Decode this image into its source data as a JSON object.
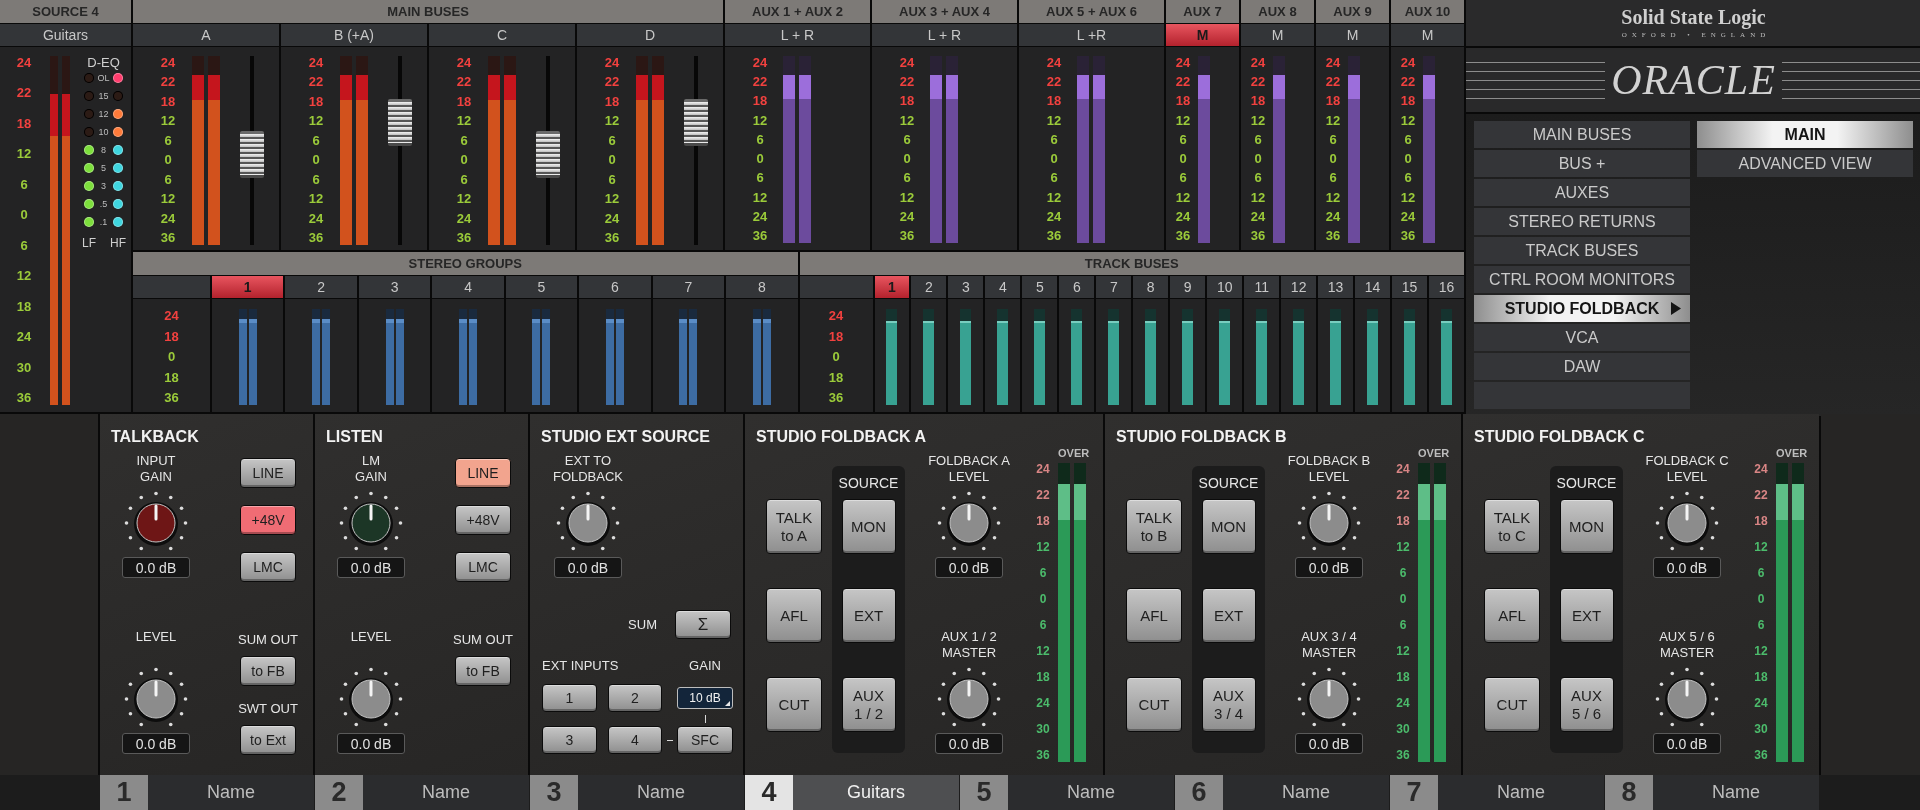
{
  "source": {
    "title": "SOURCE 4",
    "name": "Guitars",
    "scale": {
      "hot": [
        "24",
        "22",
        "18"
      ],
      "normal": [
        "12",
        "6",
        "0",
        "6",
        "12",
        "18",
        "24",
        "30",
        "36"
      ]
    },
    "meters": [
      {
        "level": 0.89
      },
      {
        "level": 0.89
      }
    ],
    "deq": {
      "title": "D-EQ",
      "rows": [
        {
          "label": "OL",
          "lf": {
            "on": false
          },
          "hf": {
            "on": true,
            "color": "#ff3d6e"
          }
        },
        {
          "label": "15",
          "lf": {
            "on": false
          },
          "hf": {
            "on": false
          }
        },
        {
          "label": "12",
          "lf": {
            "on": false
          },
          "hf": {
            "on": true,
            "color": "#ff7b3a"
          }
        },
        {
          "label": "10",
          "lf": {
            "on": false
          },
          "hf": {
            "on": true,
            "color": "#ff7b3a"
          }
        },
        {
          "label": "8",
          "lf": {
            "on": true,
            "color": "#7ddf3c"
          },
          "hf": {
            "on": true,
            "color": "#3fd6e0"
          }
        },
        {
          "label": "5",
          "lf": {
            "on": true,
            "color": "#7ddf3c"
          },
          "hf": {
            "on": true,
            "color": "#3fd6e0"
          }
        },
        {
          "label": "3",
          "lf": {
            "on": true,
            "color": "#7ddf3c"
          },
          "hf": {
            "on": true,
            "color": "#3fd6e0"
          }
        },
        {
          "label": ".5",
          "lf": {
            "on": true,
            "color": "#7ddf3c"
          },
          "hf": {
            "on": true,
            "color": "#3fd6e0"
          }
        },
        {
          "label": ".1",
          "lf": {
            "on": true,
            "color": "#7ddf3c"
          },
          "hf": {
            "on": true,
            "color": "#3fd6e0"
          }
        }
      ],
      "lf_label": "LF",
      "hf_label": "HF"
    }
  },
  "main_buses": {
    "title": "MAIN BUSES",
    "channels": [
      {
        "label": "A",
        "selected": false,
        "scale": {
          "hot": [
            "24",
            "22",
            "18"
          ],
          "normal": [
            "12",
            "6",
            "0",
            "6",
            "12",
            "24",
            "36"
          ]
        },
        "meters": [
          {
            "level": 0.9
          },
          {
            "level": 0.9
          }
        ],
        "fader": {
          "level": 0.47
        }
      },
      {
        "label": "B (+A)",
        "selected": false,
        "scale": {
          "hot": [
            "24",
            "22",
            "18"
          ],
          "normal": [
            "12",
            "6",
            "0",
            "6",
            "12",
            "24",
            "36"
          ]
        },
        "meters": [
          {
            "level": 0.9
          },
          {
            "level": 0.9
          }
        ],
        "fader": {
          "level": 0.7
        }
      },
      {
        "label": "C",
        "selected": false,
        "scale": {
          "hot": [
            "24",
            "22",
            "18"
          ],
          "normal": [
            "12",
            "6",
            "0",
            "6",
            "12",
            "24",
            "36"
          ]
        },
        "meters": [
          {
            "level": 0.9
          },
          {
            "level": 0.9
          }
        ],
        "fader": {
          "level": 0.47
        }
      },
      {
        "label": "D",
        "selected": false,
        "scale": {
          "hot": [
            "24",
            "22",
            "18"
          ],
          "normal": [
            "12",
            "6",
            "0",
            "6",
            "12",
            "24",
            "36"
          ]
        },
        "meters": [
          {
            "level": 0.9
          },
          {
            "level": 0.9
          }
        ],
        "fader": {
          "level": 0.7
        }
      }
    ]
  },
  "auxes": [
    {
      "title": "AUX 1 + AUX 2",
      "label": "L + R",
      "selected": false,
      "scale": {
        "hot": [
          "24",
          "22",
          "18"
        ],
        "normal": [
          "12",
          "6",
          "0",
          "6",
          "12",
          "24",
          "36"
        ]
      },
      "meters": [
        {
          "level": 0.9
        },
        {
          "level": 0.9
        }
      ]
    },
    {
      "title": "AUX 3 + AUX 4",
      "label": "L + R",
      "selected": false,
      "scale": {
        "hot": [
          "24",
          "22",
          "18"
        ],
        "normal": [
          "12",
          "6",
          "0",
          "6",
          "12",
          "24",
          "36"
        ]
      },
      "meters": [
        {
          "level": 0.9
        },
        {
          "level": 0.9
        }
      ]
    },
    {
      "title": "AUX 5 + AUX 6",
      "label": "L +R",
      "selected": false,
      "scale": {
        "hot": [
          "24",
          "22",
          "18"
        ],
        "normal": [
          "12",
          "6",
          "0",
          "6",
          "12",
          "24",
          "36"
        ]
      },
      "meters": [
        {
          "level": 0.9
        },
        {
          "level": 0.9
        }
      ]
    },
    {
      "title": "AUX 7",
      "label": "M",
      "selected": true,
      "scale": {
        "hot": [
          "24",
          "22",
          "18"
        ],
        "normal": [
          "12",
          "6",
          "0",
          "6",
          "12",
          "24",
          "36"
        ]
      },
      "meters": [
        {
          "level": 0.9
        }
      ]
    },
    {
      "title": "AUX 8",
      "label": "M",
      "selected": false,
      "scale": {
        "hot": [
          "24",
          "22",
          "18"
        ],
        "normal": [
          "12",
          "6",
          "0",
          "6",
          "12",
          "24",
          "36"
        ]
      },
      "meters": [
        {
          "level": 0.9
        }
      ]
    },
    {
      "title": "AUX 9",
      "label": "M",
      "selected": false,
      "scale": {
        "hot": [
          "24",
          "22",
          "18"
        ],
        "normal": [
          "12",
          "6",
          "0",
          "6",
          "12",
          "24",
          "36"
        ]
      },
      "meters": [
        {
          "level": 0.9
        }
      ]
    },
    {
      "title": "AUX 10",
      "label": "M",
      "selected": false,
      "scale": {
        "hot": [
          "24",
          "22",
          "18"
        ],
        "normal": [
          "12",
          "6",
          "0",
          "6",
          "12",
          "24",
          "36"
        ]
      },
      "meters": [
        {
          "level": 0.9
        }
      ]
    }
  ],
  "stereo_groups": {
    "title": "STEREO GROUPS",
    "scale": {
      "hot": [
        "24",
        "18"
      ],
      "normal": [
        "0",
        "18",
        "36"
      ]
    },
    "groups": [
      {
        "label": "1",
        "selected": true,
        "meters": [
          {
            "level": 0.9
          },
          {
            "level": 0.9
          }
        ]
      },
      {
        "label": "2",
        "selected": false,
        "meters": [
          {
            "level": 0.9
          },
          {
            "level": 0.9
          }
        ]
      },
      {
        "label": "3",
        "selected": false,
        "meters": [
          {
            "level": 0.9
          },
          {
            "level": 0.9
          }
        ]
      },
      {
        "label": "4",
        "selected": false,
        "meters": [
          {
            "level": 0.9
          },
          {
            "level": 0.9
          }
        ]
      },
      {
        "label": "5",
        "selected": false,
        "meters": [
          {
            "level": 0.9
          },
          {
            "level": 0.9
          }
        ]
      },
      {
        "label": "6",
        "selected": false,
        "meters": [
          {
            "level": 0.9
          },
          {
            "level": 0.9
          }
        ]
      },
      {
        "label": "7",
        "selected": false,
        "meters": [
          {
            "level": 0.9
          },
          {
            "level": 0.9
          }
        ]
      },
      {
        "label": "8",
        "selected": false,
        "meters": [
          {
            "level": 0.9
          },
          {
            "level": 0.9
          }
        ]
      }
    ]
  },
  "track_buses": {
    "title": "TRACK BUSES",
    "scale": {
      "hot": [
        "24",
        "18"
      ],
      "normal": [
        "0",
        "18",
        "36"
      ]
    },
    "buses": [
      {
        "label": "1",
        "selected": true,
        "meters": [
          {
            "level": 0.88
          }
        ]
      },
      {
        "label": "2",
        "selected": false,
        "meters": [
          {
            "level": 0.88
          }
        ]
      },
      {
        "label": "3",
        "selected": false,
        "meters": [
          {
            "level": 0.88
          }
        ]
      },
      {
        "label": "4",
        "selected": false,
        "meters": [
          {
            "level": 0.88
          }
        ]
      },
      {
        "label": "5",
        "selected": false,
        "meters": [
          {
            "level": 0.88
          }
        ]
      },
      {
        "label": "6",
        "selected": false,
        "meters": [
          {
            "level": 0.88
          }
        ]
      },
      {
        "label": "7",
        "selected": false,
        "meters": [
          {
            "level": 0.88
          }
        ]
      },
      {
        "label": "8",
        "selected": false,
        "meters": [
          {
            "level": 0.88
          }
        ]
      },
      {
        "label": "9",
        "selected": false,
        "meters": [
          {
            "level": 0.88
          }
        ]
      },
      {
        "label": "10",
        "selected": false,
        "meters": [
          {
            "level": 0.88
          }
        ]
      },
      {
        "label": "11",
        "selected": false,
        "meters": [
          {
            "level": 0.88
          }
        ]
      },
      {
        "label": "12",
        "selected": false,
        "meters": [
          {
            "level": 0.88
          }
        ]
      },
      {
        "label": "13",
        "selected": false,
        "meters": [
          {
            "level": 0.88
          }
        ]
      },
      {
        "label": "14",
        "selected": false,
        "meters": [
          {
            "level": 0.88
          }
        ]
      },
      {
        "label": "15",
        "selected": false,
        "meters": [
          {
            "level": 0.88
          }
        ]
      },
      {
        "label": "16",
        "selected": false,
        "meters": [
          {
            "level": 0.88
          }
        ]
      }
    ]
  },
  "brand": {
    "name": "Solid State Logic",
    "tagline": "OXFORD • ENGLAND",
    "product": "ORACLE"
  },
  "menu": {
    "items": [
      {
        "label": "MAIN BUSES",
        "selected": false
      },
      {
        "label": "BUS +",
        "selected": false
      },
      {
        "label": "AUXES",
        "selected": false
      },
      {
        "label": "STEREO RETURNS",
        "selected": false
      },
      {
        "label": "TRACK BUSES",
        "selected": false
      },
      {
        "label": "CTRL ROOM MONITORS",
        "selected": false
      },
      {
        "label": "STUDIO FOLDBACK",
        "selected": true
      },
      {
        "label": "VCA",
        "selected": false
      },
      {
        "label": "DAW",
        "selected": false
      }
    ],
    "views": [
      {
        "label": "MAIN",
        "selected": true
      },
      {
        "label": "ADVANCED VIEW",
        "selected": false
      }
    ]
  },
  "talkback": {
    "title": "TALKBACK",
    "knobs": [
      {
        "label": "INPUT\nGAIN",
        "value": "0.0 dB",
        "color": "#6e1616"
      },
      {
        "label": "LEVEL",
        "value": "0.0 dB",
        "color": "#8c8c8c"
      }
    ],
    "buttons": [
      {
        "label": "LINE",
        "on": false
      },
      {
        "label": "+48V",
        "on": true,
        "color": "#f06c74"
      },
      {
        "label": "LMC",
        "on": false
      }
    ],
    "outputs": [
      {
        "label": "SUM OUT",
        "button": {
          "label": "to FB",
          "on": false
        }
      },
      {
        "label": "SWT OUT",
        "button": {
          "label": "to Ext",
          "on": false
        }
      }
    ]
  },
  "listen": {
    "title": "LISTEN",
    "knobs": [
      {
        "label": "LM\nGAIN",
        "value": "0.0 dB",
        "color": "#1c3626"
      },
      {
        "label": "LEVEL",
        "value": "0.0 dB",
        "color": "#8c8c8c"
      }
    ],
    "buttons": [
      {
        "label": "LINE",
        "on": true,
        "color": "#f2a48e"
      },
      {
        "label": "+48V",
        "on": false
      },
      {
        "label": "LMC",
        "on": false
      }
    ],
    "outputs": [
      {
        "label": "SUM OUT",
        "button": {
          "label": "to FB",
          "on": false
        }
      }
    ]
  },
  "ext_source": {
    "title": "STUDIO EXT SOURCE",
    "knob": {
      "label": "EXT TO\nFOLDBACK",
      "value": "0.0 dB",
      "color": "#8c8c8c"
    },
    "sum": {
      "label": "SUM",
      "button": {
        "label": "Σ",
        "on": false
      }
    },
    "inputs_label": "EXT INPUTS",
    "inputs": [
      {
        "label": "1",
        "on": false
      },
      {
        "label": "2",
        "on": false
      },
      {
        "label": "3",
        "on": false
      },
      {
        "label": "4",
        "on": false
      }
    ],
    "gain_label": "GAIN",
    "gain": {
      "value": "10 dB"
    },
    "sfc": {
      "label": "SFC",
      "on": false
    }
  },
  "foldbacks": [
    {
      "title": "STUDIO FOLDBACK A",
      "buttons": [
        {
          "label": "TALK\nto A",
          "on": false
        },
        {
          "label": "AFL",
          "on": false
        },
        {
          "label": "CUT",
          "on": false
        }
      ],
      "source_label": "SOURCE",
      "sources": [
        {
          "label": "MON",
          "on": false
        },
        {
          "label": "EXT",
          "on": false
        },
        {
          "label": "AUX\n1 / 2",
          "on": false
        }
      ],
      "knobs": [
        {
          "label": "FOLDBACK A\nLEVEL",
          "value": "0.0 dB",
          "color": "#8c8c8c"
        },
        {
          "label": "AUX 1 / 2\nMASTER",
          "value": "0.0 dB",
          "color": "#8c8c8c"
        }
      ],
      "over_label": "OVER",
      "scale": {
        "hot": [
          "24",
          "22",
          "18"
        ],
        "normal": [
          "12",
          "6",
          "0",
          "6",
          "12",
          "18",
          "24",
          "30",
          "36"
        ]
      },
      "meters": [
        {
          "level": 0.93
        },
        {
          "level": 0.93
        }
      ]
    },
    {
      "title": "STUDIO FOLDBACK B",
      "buttons": [
        {
          "label": "TALK\nto B",
          "on": false
        },
        {
          "label": "AFL",
          "on": false
        },
        {
          "label": "CUT",
          "on": false
        }
      ],
      "source_label": "SOURCE",
      "sources": [
        {
          "label": "MON",
          "on": false
        },
        {
          "label": "EXT",
          "on": false
        },
        {
          "label": "AUX\n3 / 4",
          "on": false
        }
      ],
      "knobs": [
        {
          "label": "FOLDBACK B\nLEVEL",
          "value": "0.0 dB",
          "color": "#8c8c8c"
        },
        {
          "label": "AUX 3 / 4\nMASTER",
          "value": "0.0 dB",
          "color": "#8c8c8c"
        }
      ],
      "over_label": "OVER",
      "scale": {
        "hot": [
          "24",
          "22",
          "18"
        ],
        "normal": [
          "12",
          "6",
          "0",
          "6",
          "12",
          "18",
          "24",
          "30",
          "36"
        ]
      },
      "meters": [
        {
          "level": 0.93
        },
        {
          "level": 0.93
        }
      ]
    },
    {
      "title": "STUDIO FOLDBACK C",
      "buttons": [
        {
          "label": "TALK\nto C",
          "on": false
        },
        {
          "label": "AFL",
          "on": false
        },
        {
          "label": "CUT",
          "on": false
        }
      ],
      "source_label": "SOURCE",
      "sources": [
        {
          "label": "MON",
          "on": false
        },
        {
          "label": "EXT",
          "on": false
        },
        {
          "label": "AUX\n5 / 6",
          "on": false
        }
      ],
      "knobs": [
        {
          "label": "FOLDBACK C\nLEVEL",
          "value": "0.0 dB",
          "color": "#8c8c8c"
        },
        {
          "label": "AUX 5 / 6\nMASTER",
          "value": "0.0 dB",
          "color": "#8c8c8c"
        }
      ],
      "over_label": "OVER",
      "scale": {
        "hot": [
          "24",
          "22",
          "18"
        ],
        "normal": [
          "12",
          "6",
          "0",
          "6",
          "12",
          "18",
          "24",
          "30",
          "36"
        ]
      },
      "meters": [
        {
          "level": 0.93
        },
        {
          "level": 0.93
        }
      ]
    }
  ],
  "strips": [
    {
      "number": "1",
      "name": "Name",
      "selected": false
    },
    {
      "number": "2",
      "name": "Name",
      "selected": false
    },
    {
      "number": "3",
      "name": "Name",
      "selected": false
    },
    {
      "number": "4",
      "name": "Guitars",
      "selected": true
    },
    {
      "number": "5",
      "name": "Name",
      "selected": false
    },
    {
      "number": "6",
      "name": "Name",
      "selected": false
    },
    {
      "number": "7",
      "name": "Name",
      "selected": false
    },
    {
      "number": "8",
      "name": "Name",
      "selected": false
    }
  ]
}
